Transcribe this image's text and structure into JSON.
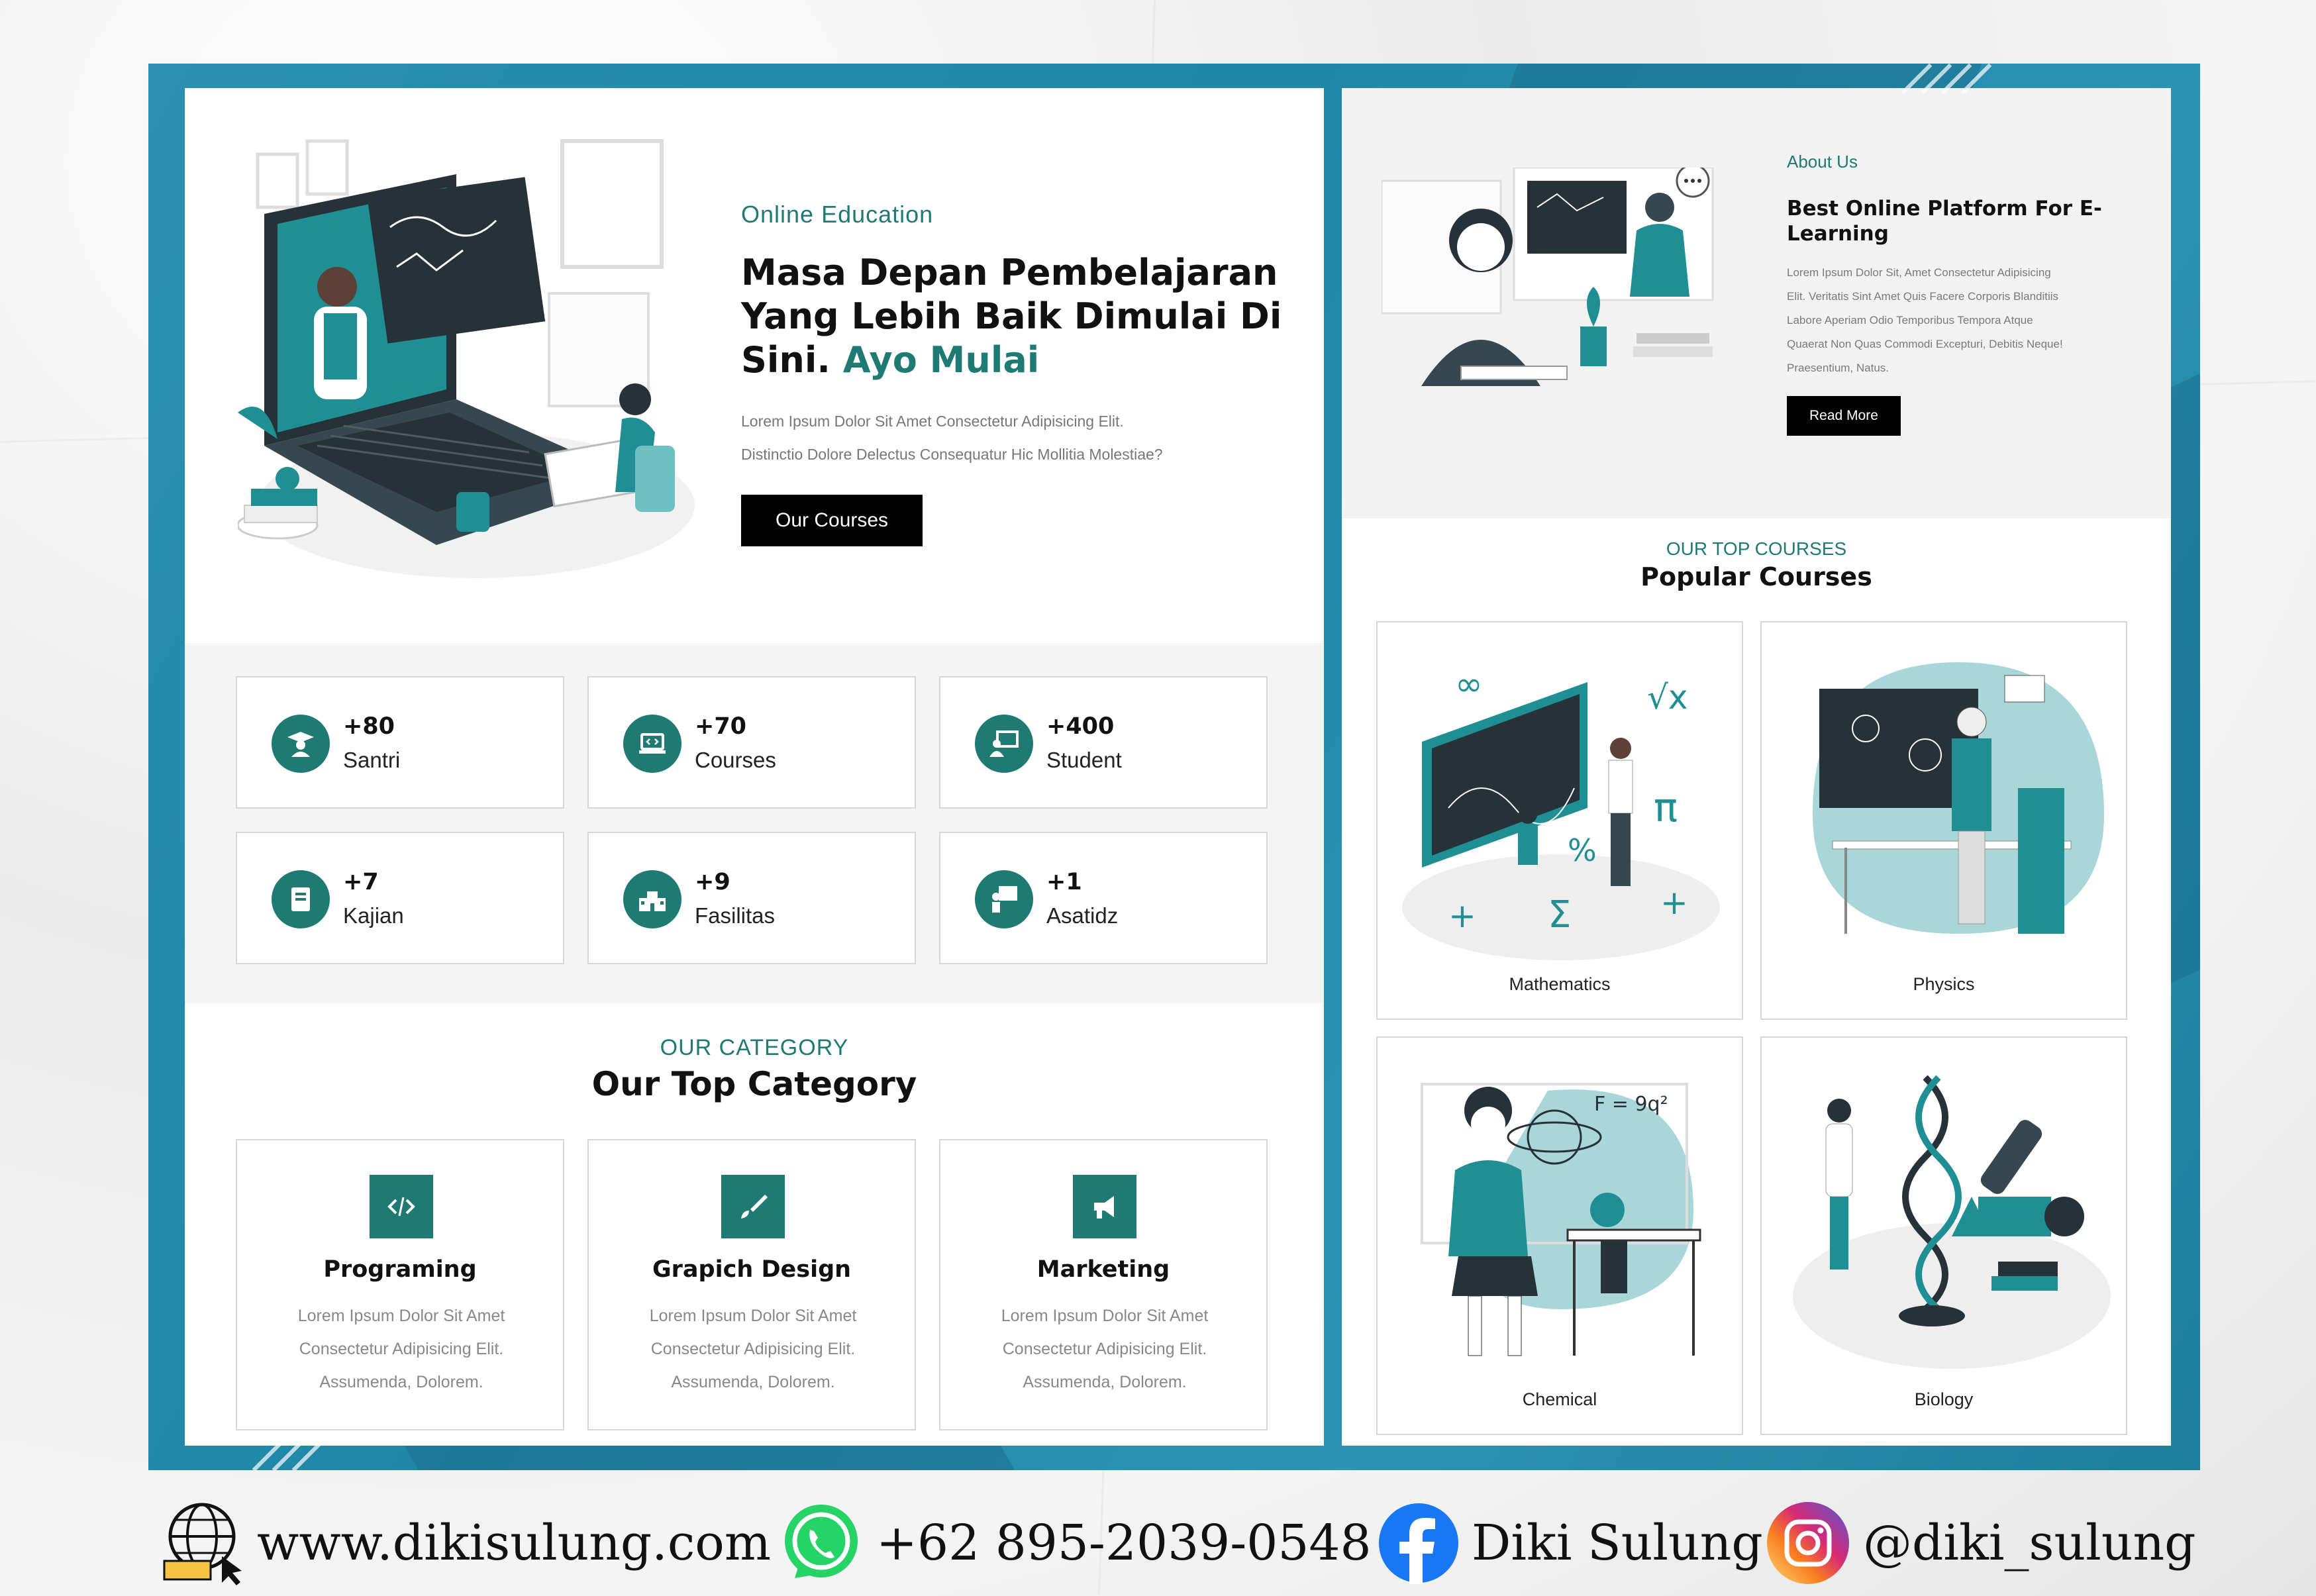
{
  "hero": {
    "eyebrow": "Online Education",
    "title_line1": "Masa Depan Pembelajaran",
    "title_line2": "Yang Lebih Baik Dimulai Di",
    "title_line3": "Sini.",
    "title_accent": "Ayo Mulai",
    "description_line1": "Lorem Ipsum Dolor Sit Amet Consectetur Adipisicing Elit.",
    "description_line2": "Distinctio Dolore Delectus Consequatur Hic Mollitia Molestiae?",
    "button": "Our Courses"
  },
  "stats": [
    {
      "value": "+80",
      "label": "Santri",
      "icon": "graduate-icon"
    },
    {
      "value": "+70",
      "label": "Courses",
      "icon": "laptop-code-icon"
    },
    {
      "value": "+400",
      "label": "Student",
      "icon": "teacher-board-icon"
    },
    {
      "value": "+7",
      "label": "Kajian",
      "icon": "book-icon"
    },
    {
      "value": "+9",
      "label": "Fasilitas",
      "icon": "school-icon"
    },
    {
      "value": "+1",
      "label": "Asatidz",
      "icon": "chalkboard-teacher-icon"
    }
  ],
  "category": {
    "eyebrow": "OUR CATEGORY",
    "title": "Our Top Category",
    "items": [
      {
        "name": "Programing",
        "icon": "code-icon",
        "desc1": "Lorem Ipsum Dolor Sit Amet",
        "desc2": "Consectetur Adipisicing Elit.",
        "desc3": "Assumenda, Dolorem."
      },
      {
        "name": "Grapich Design",
        "icon": "brush-icon",
        "desc1": "Lorem Ipsum Dolor Sit Amet",
        "desc2": "Consectetur Adipisicing Elit.",
        "desc3": "Assumenda, Dolorem."
      },
      {
        "name": "Marketing",
        "icon": "megaphone-icon",
        "desc1": "Lorem Ipsum Dolor Sit Amet",
        "desc2": "Consectetur Adipisicing Elit.",
        "desc3": "Assumenda, Dolorem."
      }
    ]
  },
  "about": {
    "eyebrow": "About Us",
    "title_line1": "Best Online Platform For E-",
    "title_line2": "Learning",
    "desc_line1": "Lorem Ipsum Dolor Sit, Amet Consectetur Adipisicing",
    "desc_line2": "Elit. Veritatis Sint Amet Quis Facere Corporis Blanditiis",
    "desc_line3": "Labore Aperiam Odio Temporibus Tempora Atque",
    "desc_line4": "Quaerat Non Quas Commodi Excepturi, Debitis Neque!",
    "desc_line5": "Praesentium, Natus.",
    "button": "Read More"
  },
  "popular": {
    "eyebrow": "OUR TOP COURSES",
    "title": "Popular Courses",
    "courses": [
      {
        "name": "Mathematics"
      },
      {
        "name": "Physics"
      },
      {
        "name": "Chemical"
      },
      {
        "name": "Biology"
      }
    ]
  },
  "footer": {
    "website": "www.dikisulung.com",
    "whatsapp": "+62 895-2039-0548",
    "facebook": "Diki Sulung",
    "instagram": "@diki_sulung"
  },
  "colors": {
    "accent": "#1f7a74",
    "frame": "#2a8fb0",
    "button": "#000000"
  }
}
